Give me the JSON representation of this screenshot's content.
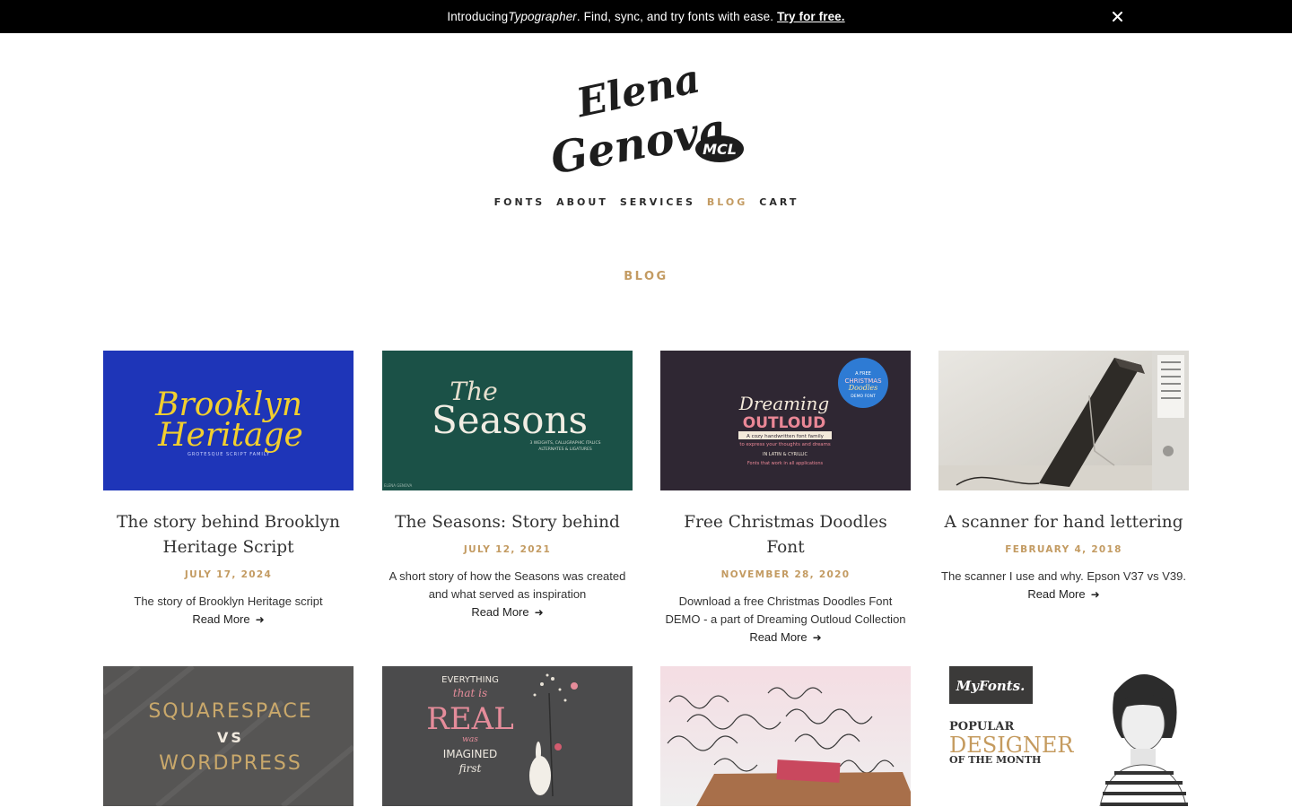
{
  "announcement": {
    "prefix": "Introducing ",
    "product": "Typographer",
    "suffix": ". Find, sync, and try fonts with ease.",
    "cta": "Try for free.",
    "close_icon": "close-icon"
  },
  "logo": {
    "line1": "Elena",
    "line2": "Genova",
    "badge": "MCL"
  },
  "nav": {
    "items": [
      {
        "label": "FONTS"
      },
      {
        "label": "ABOUT"
      },
      {
        "label": "SERVICES"
      },
      {
        "label": "BLOG"
      },
      {
        "label": "CART"
      }
    ],
    "active": "BLOG"
  },
  "page_title": "BLOG",
  "colors": {
    "accent": "#c39b62",
    "announcement_bg": "#000000",
    "text": "#222222"
  },
  "posts": [
    {
      "title": "The story behind Brooklyn Heritage Script",
      "date": "JULY 17, 2024",
      "excerpt": "The story of Brooklyn Heritage script",
      "read_more": "Read More",
      "image": {
        "line1": "Brooklyn",
        "line2": "Heritage",
        "caption": "GROTESQUE SCRIPT FAMILY"
      }
    },
    {
      "title": "The Seasons: Story behind",
      "date": "JULY 12, 2021",
      "excerpt": "A short story of how the Seasons was created and what served as inspiration",
      "read_more": "Read More",
      "image": {
        "line1": "The",
        "line2": "Seasons",
        "caption1": "3 WEIGHTS, CALLIGRAPHIC ITALICS",
        "caption2": "ALTERNATES & LIGATURES",
        "credit": "ELENA GENOVA"
      }
    },
    {
      "title": "Free Christmas Doodles Font",
      "date": "NOVEMBER 28, 2020",
      "excerpt": "Download a free Christmas Doodles Font DEMO - a part of Dreaming Outloud Collection",
      "read_more": "Read More",
      "image": {
        "line1": "Dreaming",
        "line2": "OUTLOUD",
        "line3": "A cozy handwritten font family",
        "line4": "to express your thoughts and dreams",
        "line5": "IN LATIN & CYRILLIC",
        "line6": "Fonts that work in all applications",
        "badge1": "A FREE",
        "badge2": "CHRISTMAS",
        "badge3": "Doodles",
        "badge4": "DEMO FONT"
      }
    },
    {
      "title": "A scanner for hand lettering",
      "date": "FEBRUARY 4, 2018",
      "excerpt": "The scanner I use and why. Epson V37 vs V39.",
      "read_more": "Read More",
      "image": {}
    },
    {
      "title": "",
      "date": "",
      "excerpt": "",
      "read_more": "",
      "image": {
        "line1": "SQUARESPACE",
        "line2": "VS",
        "line3": "WORDPRESS"
      }
    },
    {
      "title": "",
      "date": "",
      "excerpt": "",
      "read_more": "",
      "image": {
        "line1": "EVERYTHING",
        "line2": "that is",
        "line3": "REAL",
        "line4": "was",
        "line5": "IMAGINED",
        "line6": "first"
      }
    },
    {
      "title": "",
      "date": "",
      "excerpt": "",
      "read_more": "",
      "image": {}
    },
    {
      "title": "",
      "date": "",
      "excerpt": "",
      "read_more": "",
      "image": {
        "brand": "MyFonts.",
        "line1": "POPULAR",
        "line2": "DESIGNER",
        "line3": "OF THE MONTH"
      }
    }
  ]
}
